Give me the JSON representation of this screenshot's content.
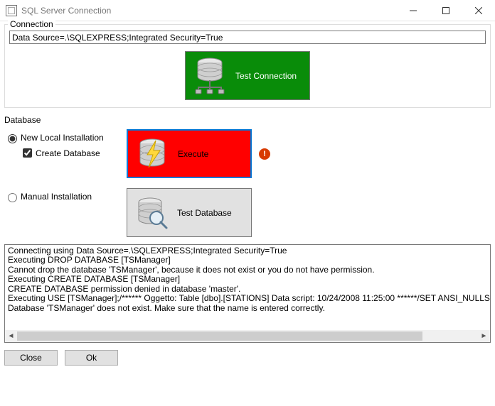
{
  "window": {
    "title": "SQL Server Connection"
  },
  "connection": {
    "legend": "Connection",
    "value": "Data Source=.\\SQLEXPRESS;Integrated Security=True",
    "test_button": "Test Connection"
  },
  "database": {
    "legend": "Database",
    "new_local_label": "New Local Installation",
    "create_db_label": "Create Database",
    "manual_label": "Manual Installation",
    "execute_button": "Execute",
    "test_db_button": "Test Database",
    "new_local_selected": true,
    "create_db_checked": true,
    "manual_selected": false
  },
  "log": {
    "lines": [
      "Connecting using Data Source=.\\SQLEXPRESS;Integrated Security=True",
      "Executing DROP DATABASE [TSManager]",
      "Cannot drop the database 'TSManager', because it does not exist or you do not have permission.",
      "Executing CREATE DATABASE [TSManager]",
      "CREATE DATABASE permission denied in database 'master'.",
      "Executing USE [TSManager];/****** Oggetto:  Table [dbo].[STATIONS]    Data script: 10/24/2008 11:25:00 ******/SET ANSI_NULLS ON;SET QUOTED_IDENTIFIER ON;",
      "Database 'TSManager' does not exist. Make sure that the name is entered correctly."
    ]
  },
  "footer": {
    "close": "Close",
    "ok": "Ok"
  },
  "colors": {
    "success": "#098c09",
    "error_bg": "#ff0000",
    "selection": "#0078d7",
    "error_badge": "#d83b01"
  }
}
